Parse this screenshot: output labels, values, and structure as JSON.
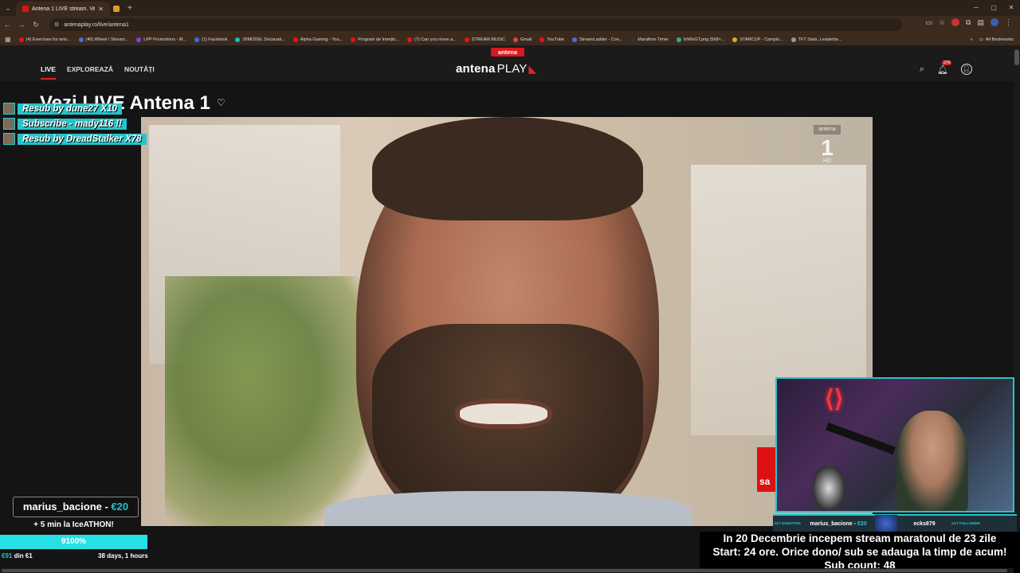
{
  "browser": {
    "tabs": [
      {
        "title": "Antena 1 LIVE stream. Vezi onl...",
        "active": true
      },
      {
        "title": "",
        "active": false
      }
    ],
    "url": "antenaplay.ro/live/antena1",
    "bookmarks": [
      "(4) Exercises for wris...",
      "(40) Wheel / Stream...",
      "LPP Promotions - M...",
      "(1) Facebook",
      "26MODEL Declarati...",
      "Alpha Gaming - You...",
      "Program de întreţin...",
      "(7) Can you move a...",
      "STREAM MUSIC",
      "Gmail",
      "YouTube",
      "StreamLadder - Con...",
      "Marathon Timer",
      "fzWlxGT.png (568×...",
      "STARCUP - Campio...",
      "TFT Stats, Leaderbo..."
    ],
    "all_bookmarks": "All Bookmarks"
  },
  "site": {
    "badge": "antena",
    "logo_main": "antena",
    "logo_play": "PLAY",
    "nav": [
      "LIVE",
      "EXPLOREAZĂ",
      "NOUTĂȚI"
    ],
    "notif_count": "276",
    "title": "Vezi LIVE Antena 1",
    "channel_small": "antena",
    "channel_big": "1",
    "channel_hd": "HD"
  },
  "overlay": {
    "alerts": [
      "Resub by dune27 X10",
      "Subscribe - mady116 !!",
      "Resub by DreadStalker X78"
    ],
    "donor_name": "marius_bacione - ",
    "donor_amount": "€20",
    "donor_sub": "+ 5 min la IceATHON!",
    "progress_label": "9100%",
    "progress": 1.0,
    "goal_left_a": "€91",
    "goal_left_b": " din €1",
    "goal_right": "38 days, 1 hours",
    "cam_label_left": "ULT DONATION",
    "cam_donor": "marius_bacione - ",
    "cam_donor_amt": "€20",
    "cam_follower": "ecks879",
    "cam_label_right": "ULT FOLLOWER",
    "red_tab": "sa",
    "marathon_lines": [
      "In 20 Decembrie incepem stream maratonul de 23 zile",
      "Start: 24 ore. Orice dono/ sub se adauga la timp de acum!",
      "Sub count: 48"
    ]
  }
}
